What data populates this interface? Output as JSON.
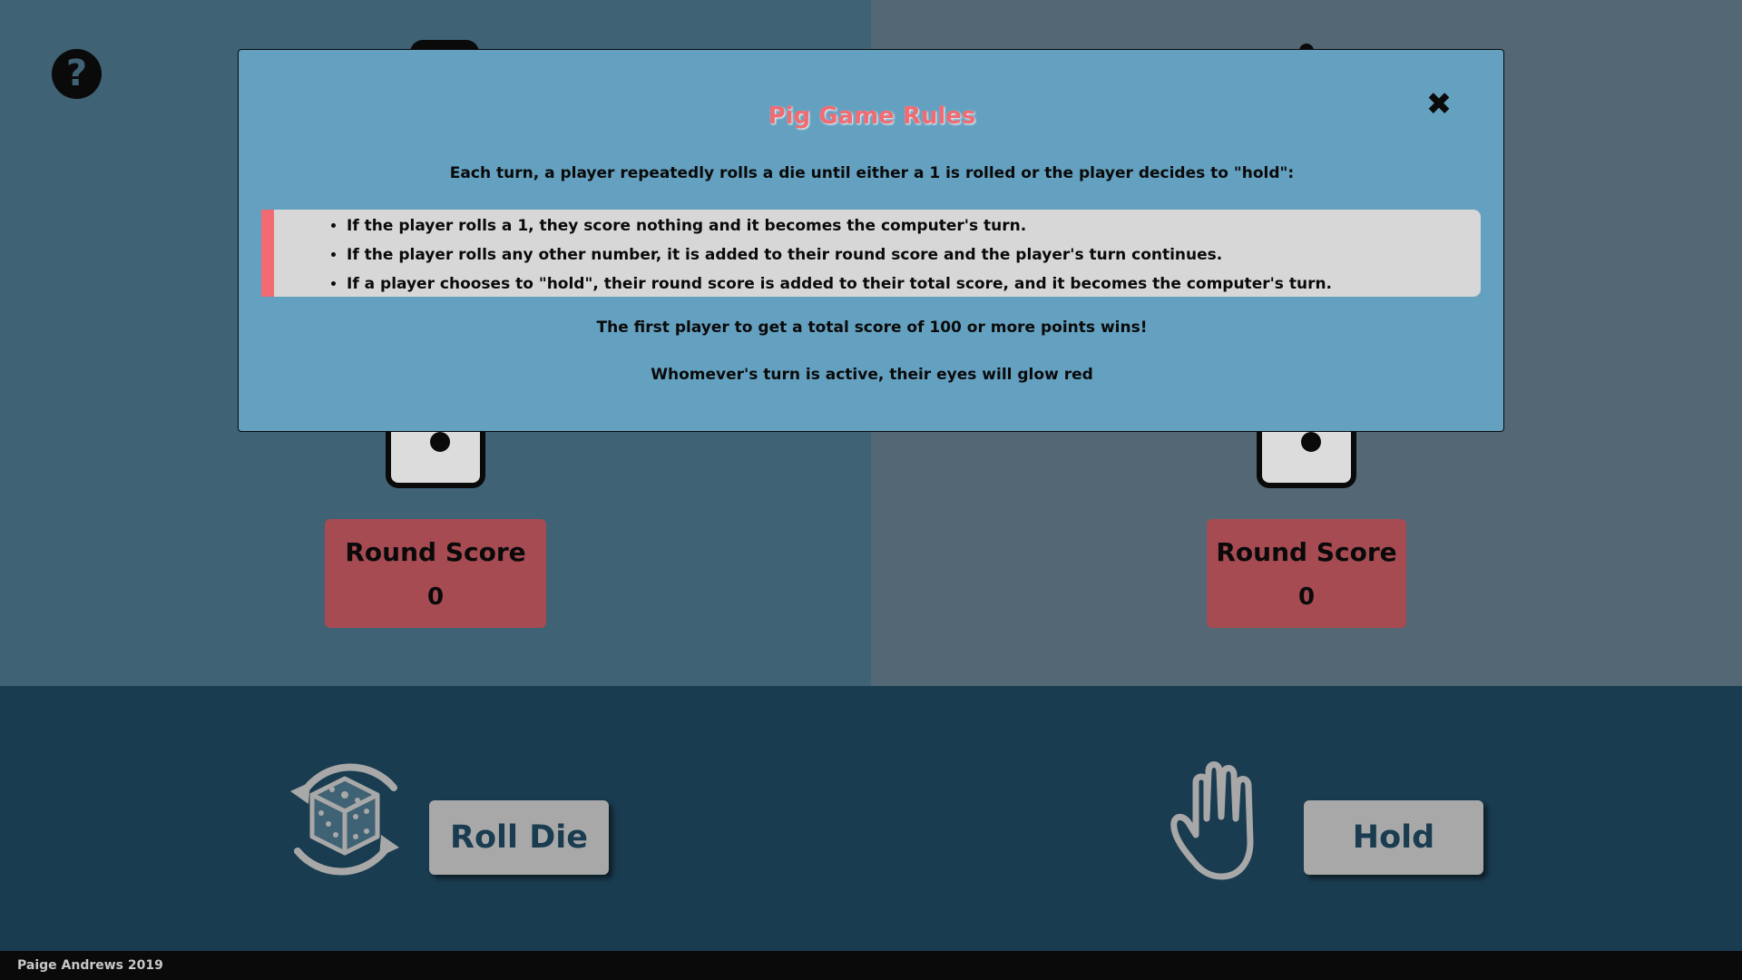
{
  "help": {
    "icon": "question-circle-icon",
    "glyph": "?"
  },
  "players": {
    "left": {
      "round_score_label": "Round Score",
      "round_score_value": "0"
    },
    "right": {
      "round_score_label": "Round Score",
      "round_score_value": "0"
    }
  },
  "controls": {
    "roll_label": "Roll Die",
    "roll_icon": "dice-roll-icon",
    "hold_label": "Hold",
    "hold_icon": "hand-icon"
  },
  "footer": {
    "credit": "Paige Andrews 2019"
  },
  "modal": {
    "title": "Pig Game Rules",
    "close_glyph": "✖",
    "intro": "Each turn, a player repeatedly rolls a die until either a 1 is rolled or the player decides to \"hold\":",
    "rules": [
      "If the player rolls a 1, they score nothing and it becomes the computer's turn.",
      "If the player rolls any other number, it is added to their round score and the player's turn continues.",
      "If a player chooses to \"hold\", their round score is added to their total score, and it becomes the computer's turn."
    ],
    "win": "The first player to get a total score of 100 or more points wins!",
    "turn_hint": "Whomever's turn is active, their eyes will glow red"
  },
  "colors": {
    "left_panel": "#3f6275",
    "right_panel": "#536874",
    "bottom_area": "#1a3c50",
    "round_card": "#a64b52",
    "modal_bg": "#64a0bf",
    "accent": "#f06b72",
    "button": "#a8a8a8"
  }
}
